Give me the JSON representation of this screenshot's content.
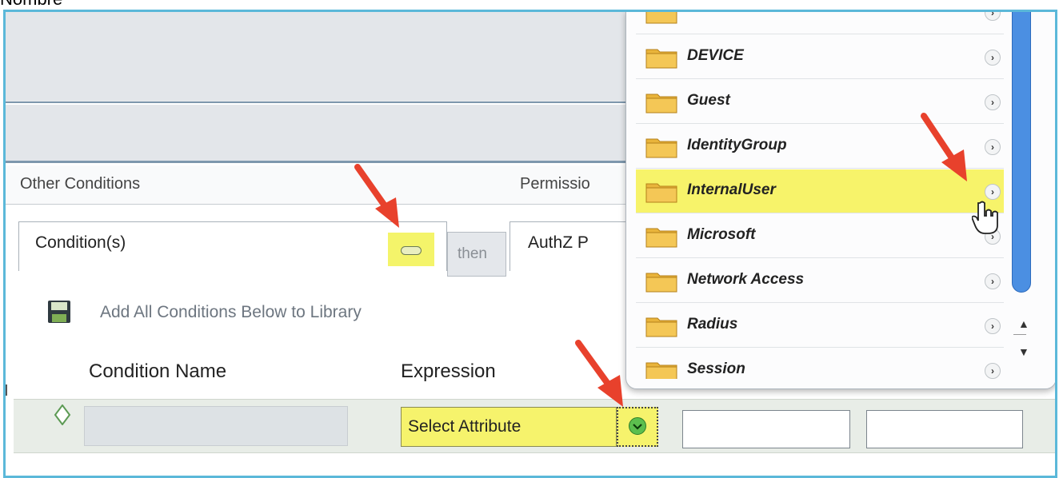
{
  "top_label": "Nombre",
  "header": {
    "other_conditions": "Other Conditions",
    "permissions": "Permissio"
  },
  "tabs": {
    "conditions": "Condition(s)",
    "then": "then",
    "authz": "AuthZ P"
  },
  "actions": {
    "add_library": "Add All Conditions Below to Library"
  },
  "columns": {
    "condition_name": "Condition Name",
    "expression": "Expression"
  },
  "row": {
    "select_attribute": "Select Attribute"
  },
  "dropdown": {
    "items": [
      {
        "label": ""
      },
      {
        "label": "DEVICE"
      },
      {
        "label": "Guest"
      },
      {
        "label": "IdentityGroup"
      },
      {
        "label": "InternalUser",
        "highlighted": true
      },
      {
        "label": "Microsoft"
      },
      {
        "label": "Network Access"
      },
      {
        "label": "Radius"
      },
      {
        "label": "Session"
      }
    ]
  },
  "colors": {
    "highlight": "#f6f36c",
    "frame": "#5bb8d9",
    "scrollbar": "#4b8fe2",
    "annotation_arrow": "#e8412c"
  }
}
